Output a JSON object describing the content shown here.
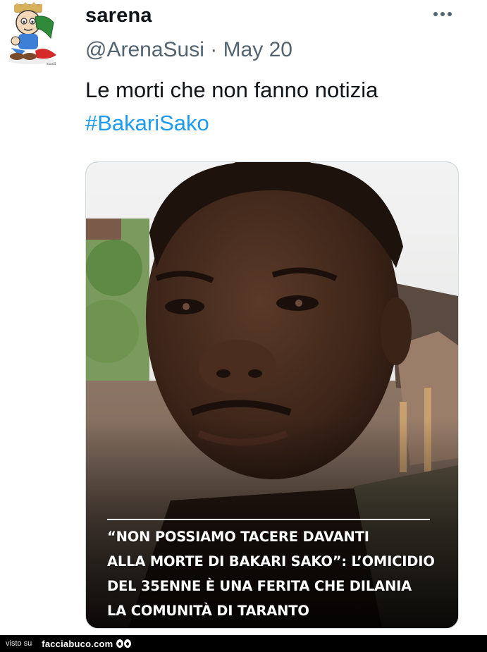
{
  "tweet": {
    "display_name": "sarena",
    "handle": "@ArenaSusi",
    "separator": "·",
    "date": "May 20",
    "text": "Le morti che non fanno notizia",
    "hashtag": "#BakariSako",
    "more_icon": "more-horizontal-icon"
  },
  "media": {
    "caption": "“NON POSSIAMO TACERE DAVANTI\nALLA MORTE DI BAKARI SAKO”: L’OMICIDIO\nDEL 35ENNE È UNA FERITA CHE DILANIA\nLA COMUNITÀ DI TARANTO"
  },
  "footer": {
    "visto": "visto su",
    "brand": "facciabuco.com",
    "logo_icon": "eyes-icon"
  },
  "colors": {
    "hashtag": "#1d9bf0",
    "handle": "#536471",
    "text": "#0f1419",
    "footer_bg": "#000000"
  }
}
